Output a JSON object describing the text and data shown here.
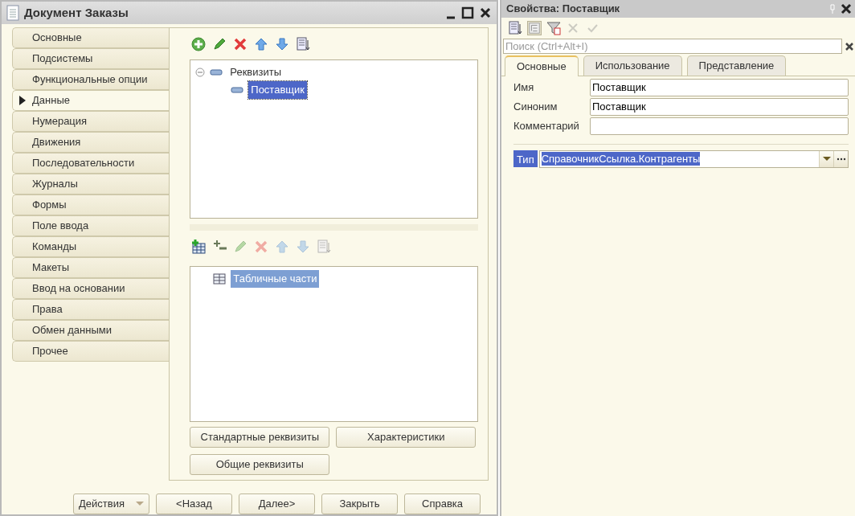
{
  "window": {
    "title": "Документ Заказы"
  },
  "sections": [
    {
      "label": "Основные",
      "selected": false
    },
    {
      "label": "Подсистемы",
      "selected": false
    },
    {
      "label": "Функциональные опции",
      "selected": false
    },
    {
      "label": "Данные",
      "selected": true
    },
    {
      "label": "Нумерация",
      "selected": false
    },
    {
      "label": "Движения",
      "selected": false
    },
    {
      "label": "Последовательности",
      "selected": false
    },
    {
      "label": "Журналы",
      "selected": false
    },
    {
      "label": "Формы",
      "selected": false
    },
    {
      "label": "Поле ввода",
      "selected": false
    },
    {
      "label": "Команды",
      "selected": false
    },
    {
      "label": "Макеты",
      "selected": false
    },
    {
      "label": "Ввод на основании",
      "selected": false
    },
    {
      "label": "Права",
      "selected": false
    },
    {
      "label": "Обмен данными",
      "selected": false
    },
    {
      "label": "Прочее",
      "selected": false
    }
  ],
  "attributes_toolbar": [
    {
      "kind": "add",
      "disabled": false
    },
    {
      "kind": "edit",
      "disabled": false
    },
    {
      "kind": "delete",
      "disabled": false
    },
    {
      "kind": "up",
      "disabled": false
    },
    {
      "kind": "down",
      "disabled": false
    },
    {
      "kind": "sort",
      "disabled": false
    }
  ],
  "attributes_tree": {
    "focused": true,
    "items": [
      {
        "label": "Реквизиты",
        "expanded": true,
        "selected": false,
        "children": [
          {
            "label": "Поставщик",
            "selected": true
          }
        ]
      }
    ]
  },
  "tabular_toolbar": [
    {
      "kind": "add-table",
      "disabled": false
    },
    {
      "kind": "add-column",
      "disabled": false
    },
    {
      "kind": "edit",
      "disabled": true
    },
    {
      "kind": "delete",
      "disabled": true
    },
    {
      "kind": "up",
      "disabled": true
    },
    {
      "kind": "down",
      "disabled": true
    },
    {
      "kind": "sort",
      "disabled": true
    }
  ],
  "tabular_tree": {
    "focused": false,
    "items": [
      {
        "label": "Табличные части",
        "selected": true
      }
    ]
  },
  "panel_buttons": [
    "Стандартные реквизиты",
    "Характеристики",
    "Общие реквизиты"
  ],
  "footer_buttons": [
    {
      "label": "Действия",
      "kind": "dropdown"
    },
    {
      "label": "<Назад",
      "kind": "plain"
    },
    {
      "label": "Далее>",
      "kind": "plain"
    },
    {
      "label": "Закрыть",
      "kind": "plain"
    },
    {
      "label": "Справка",
      "kind": "plain"
    }
  ],
  "properties": {
    "title": "Свойства: Поставщик",
    "toolbar": [
      {
        "kind": "sort",
        "pressed": false,
        "disabled": false
      },
      {
        "kind": "tree",
        "pressed": true,
        "disabled": false
      },
      {
        "kind": "filter",
        "pressed": false,
        "disabled": false
      },
      {
        "kind": "cancel",
        "pressed": false,
        "disabled": true
      },
      {
        "kind": "apply",
        "pressed": false,
        "disabled": true
      }
    ],
    "search": {
      "placeholder": "Поиск (Ctrl+Alt+I)"
    },
    "tabs": [
      {
        "label": "Основные",
        "selected": true
      },
      {
        "label": "Использование",
        "selected": false
      },
      {
        "label": "Представление",
        "selected": false
      }
    ],
    "fields": [
      {
        "label": "Имя",
        "value": "Поставщик"
      },
      {
        "label": "Синоним",
        "value": "Поставщик"
      },
      {
        "label": "Комментарий"
      }
    ],
    "type_field": {
      "label": "Тип",
      "value": "СправочникСсылка.Контрагенты",
      "selected": true
    }
  }
}
